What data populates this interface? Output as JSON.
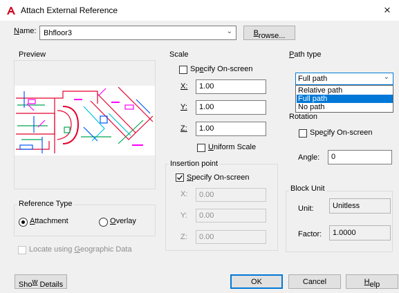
{
  "window": {
    "title": "Attach External Reference",
    "close_glyph": "×",
    "icon": "autocad-a-icon"
  },
  "name_row": {
    "label_u": "N",
    "label_rest": "ame:",
    "value": "Bhfloor3",
    "browse_u": "B",
    "browse_rest": "rowse..."
  },
  "preview": {
    "title": "Preview"
  },
  "scale": {
    "title": "Scale",
    "specify_pre": "Sp",
    "specify_u": "e",
    "specify_post": "cify On-screen",
    "specify_checked": false,
    "x_label": "X:",
    "x_value": "1.00",
    "y_label": "Y:",
    "y_value": "1.00",
    "z_label": "Z:",
    "z_value": "1.00",
    "uniform_u": "U",
    "uniform_rest": "niform Scale",
    "uniform_checked": false
  },
  "insertion": {
    "title": "Insertion point",
    "specify_u": "S",
    "specify_rest": "pecify On-screen",
    "specify_checked": true,
    "x_label": "X:",
    "x_value": "0.00",
    "y_label": "Y:",
    "y_value": "0.00",
    "z_label": "Z:",
    "z_value": "0.00"
  },
  "path_type": {
    "title_u": "P",
    "title_rest": "ath type",
    "selected": "Full path",
    "options": [
      "Relative path",
      "Full path",
      "No path"
    ],
    "highlighted_index": 1
  },
  "rotation": {
    "title": "Rotation",
    "specify_pre": "Spe",
    "specify_u": "c",
    "specify_post": "ify On-screen",
    "specify_checked": false,
    "angle_label": "Angle:",
    "angle_value": "0"
  },
  "block_unit": {
    "title": "Block Unit",
    "unit_label": "Unit:",
    "unit_value": "Unitless",
    "factor_label": "Factor:",
    "factor_value": "1.0000"
  },
  "reference_type": {
    "title": "Reference Type",
    "attachment_u": "A",
    "attachment_rest": "ttachment",
    "overlay_u": "O",
    "overlay_rest": "verlay",
    "selected": "Attachment"
  },
  "geo": {
    "pre": "Locate using ",
    "u": "G",
    "post": "eographic Data",
    "checked": false
  },
  "buttons": {
    "show_details_pre": "Sho",
    "show_details_u": "w",
    "show_details_post": " Details",
    "ok": "OK",
    "cancel": "Cancel",
    "help_u": "H",
    "help_rest": "elp"
  },
  "colors": {
    "accent": "#0078d7",
    "title_icon_red": "#d0021b",
    "plan_red": "#e4002b",
    "plan_magenta": "#ff00ff",
    "plan_green": "#00a651",
    "plan_blue": "#0057ff",
    "plan_cyan": "#00c3e0"
  }
}
